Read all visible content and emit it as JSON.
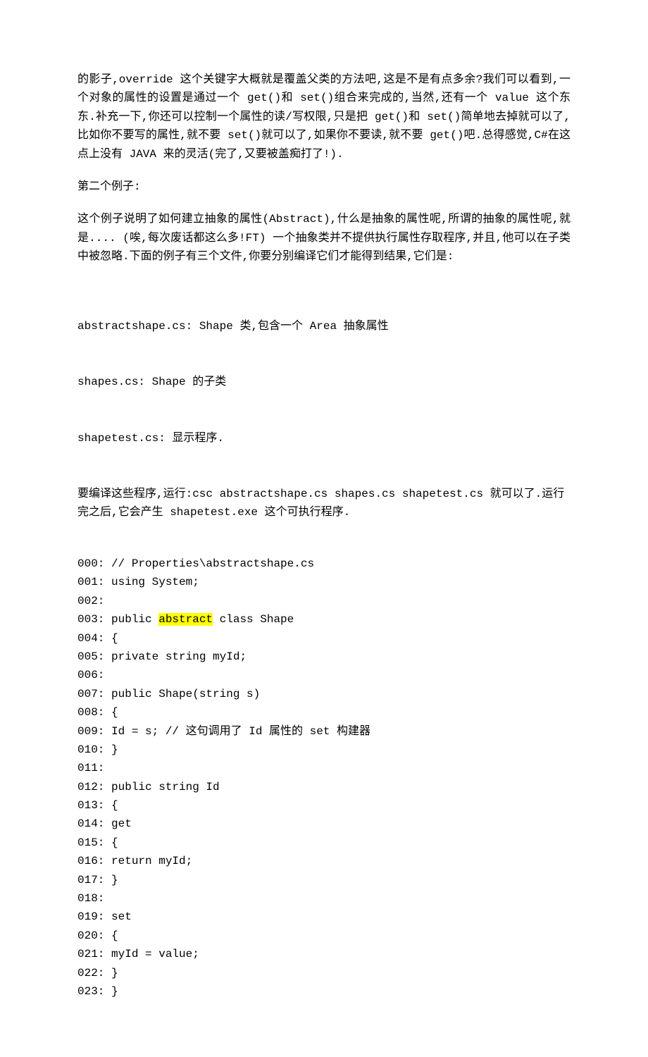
{
  "para1": "的影子,override 这个关键字大概就是覆盖父类的方法吧,这是不是有点多余?我们可以看到,一个对象的属性的设置是通过一个 get()和 set()组合来完成的,当然,还有一个 value 这个东东.补充一下,你还可以控制一个属性的读/写权限,只是把 get()和 set()简单地去掉就可以了,比如你不要写的属性,就不要 set()就可以了,如果你不要读,就不要 get()吧.总得感觉,C#在这点上没有 JAVA 来的灵活(完了,又要被盖痴打了!).",
  "para2": "第二个例子:",
  "para3": "这个例子说明了如何建立抽象的属性(Abstract),什么是抽象的属性呢,所谓的抽象的属性呢,就是.... (唉,每次废话都这么多!FT) 一个抽象类并不提供执行属性存取程序,并且,他可以在子类中被忽略.下面的例子有三个文件,你要分别编译它们才能得到结果,它们是:",
  "filelist": [
    "abstractshape.cs: Shape 类,包含一个 Area 抽象属性",
    "shapes.cs: Shape 的子类",
    "shapetest.cs: 显示程序.",
    "要编译这些程序,运行:csc abstractshape.cs shapes.cs shapetest.cs 就可以了.运行完之后,它会产生 shapetest.exe 这个可执行程序."
  ],
  "code": {
    "lines": [
      {
        "n": "000",
        "t": "// Properties\\abstractshape.cs"
      },
      {
        "n": "001",
        "t": "using System;"
      },
      {
        "n": "002",
        "t": ""
      },
      {
        "n": "003",
        "pre": "public ",
        "hl": "abstract",
        "post": " class Shape"
      },
      {
        "n": "004",
        "t": "{"
      },
      {
        "n": "005",
        "t": "private string myId;"
      },
      {
        "n": "006",
        "t": ""
      },
      {
        "n": "007",
        "t": "public Shape(string s)"
      },
      {
        "n": "008",
        "t": "{"
      },
      {
        "n": "009",
        "t": "Id = s; // 这句调用了 Id 属性的 set 构建器"
      },
      {
        "n": "010",
        "t": "}"
      },
      {
        "n": "011",
        "t": ""
      },
      {
        "n": "012",
        "t": "public string Id"
      },
      {
        "n": "013",
        "t": "{"
      },
      {
        "n": "014",
        "t": "get"
      },
      {
        "n": "015",
        "t": "{"
      },
      {
        "n": "016",
        "t": "return myId;"
      },
      {
        "n": "017",
        "t": "}"
      },
      {
        "n": "018",
        "t": ""
      },
      {
        "n": "019",
        "t": "set"
      },
      {
        "n": "020",
        "t": "{"
      },
      {
        "n": "021",
        "t": "myId = value;"
      },
      {
        "n": "022",
        "t": "}"
      },
      {
        "n": "023",
        "t": "}"
      }
    ]
  }
}
